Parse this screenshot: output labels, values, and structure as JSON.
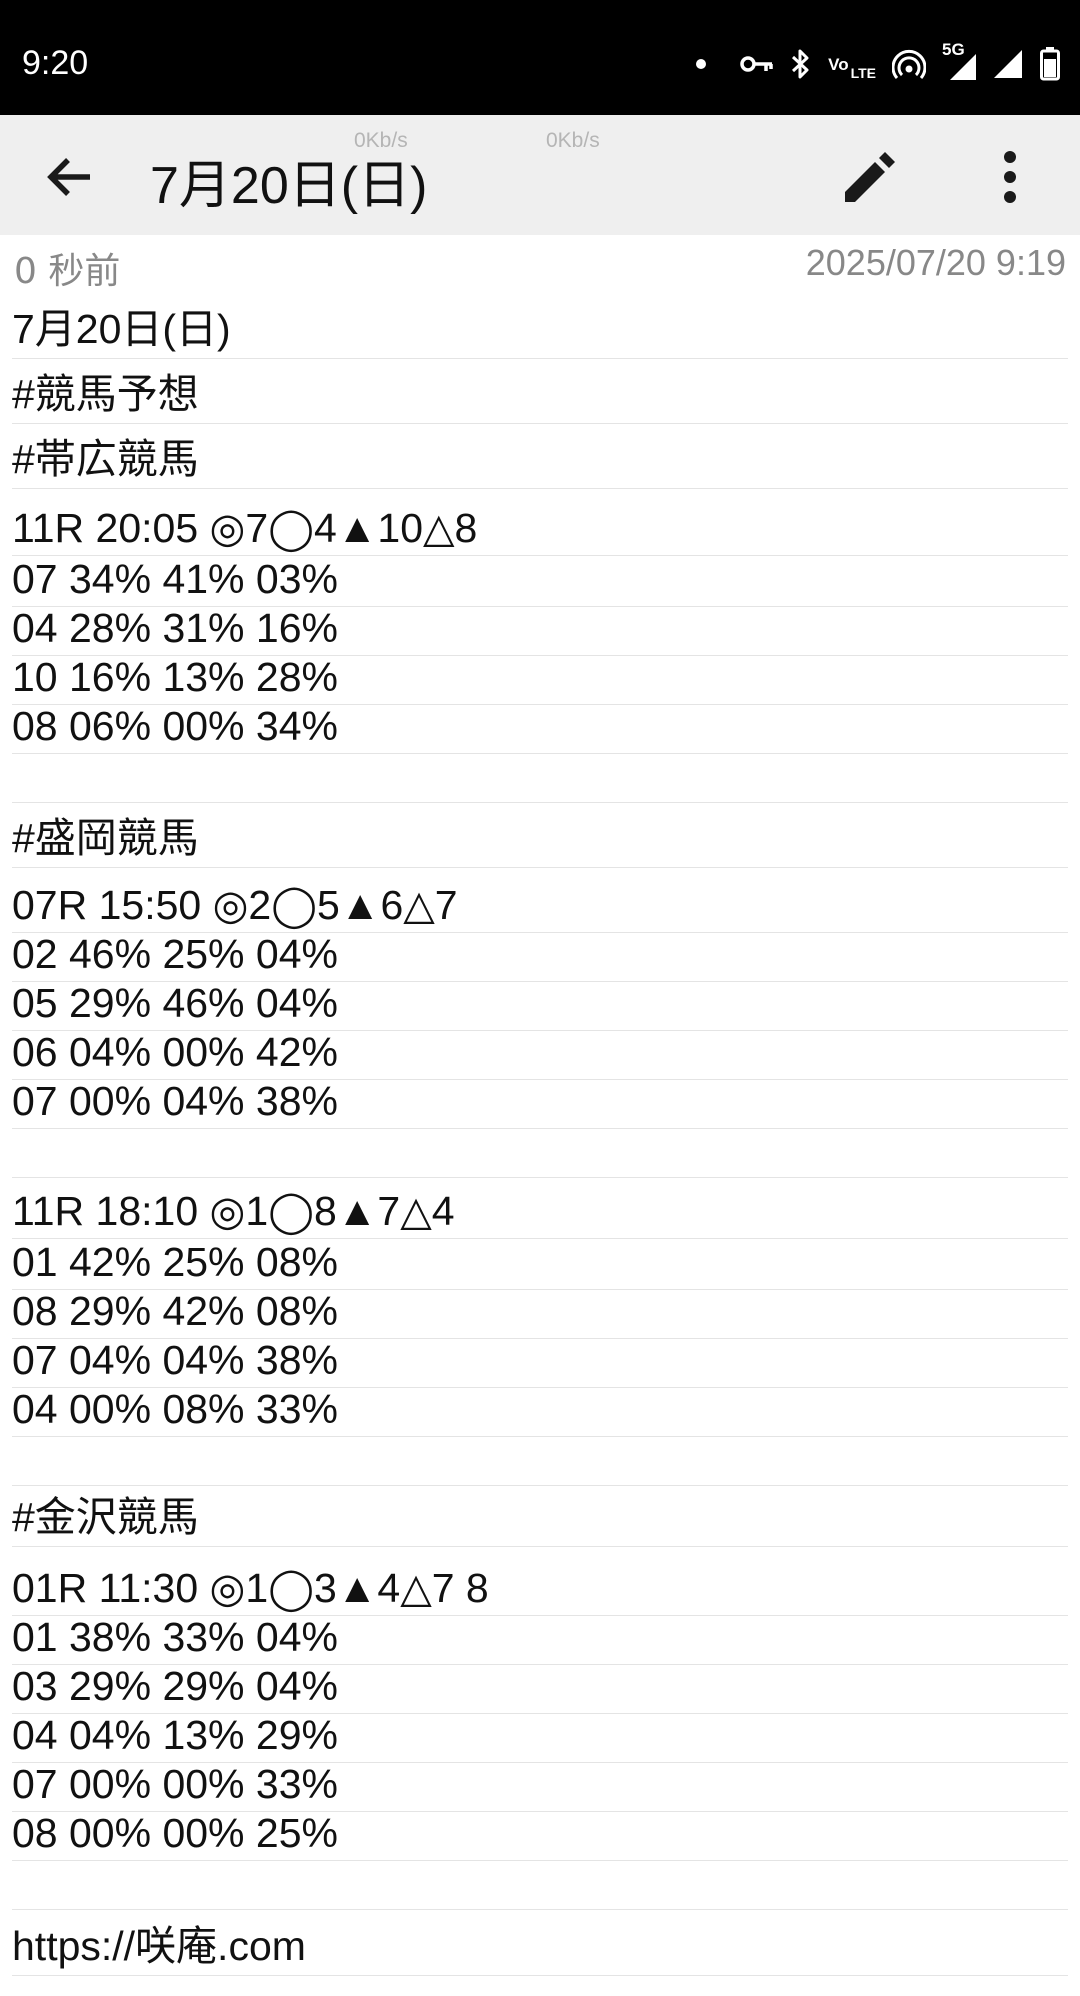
{
  "status_bar": {
    "time": "9:20",
    "icons": [
      "notification-dot-icon",
      "vpn-key-icon",
      "bluetooth-icon",
      "volte-icon",
      "hotspot-icon",
      "5g-signal-icon",
      "signal-icon",
      "battery-icon"
    ],
    "volte_label_top": "Vo",
    "volte_label_bottom": "LTE",
    "network_label": "5G"
  },
  "app_bar": {
    "title": "7月20日(日)",
    "net_speed_1": "0Kb/s",
    "net_speed_2": "0Kb/s",
    "icons": [
      "back-arrow-icon",
      "edit-pencil-icon",
      "more-vert-icon"
    ]
  },
  "meta": {
    "relative_time": "0 秒前",
    "timestamp": "2025/07/20 9:19"
  },
  "note_lines": [
    "7月20日(日)",
    "#競馬予想",
    "#帯広競馬",
    "11R 20:05 ◎7◯4▲10△8",
    "07 34% 41% 03%",
    "04 28% 31% 16%",
    "10 16% 13% 28%",
    "08 06% 00% 34%",
    "",
    "#盛岡競馬",
    "07R 15:50 ◎2◯5▲6△7",
    "02 46% 25% 04%",
    "05 29% 46% 04%",
    "06 04% 00% 42%",
    "07 00% 04% 38%",
    "",
    "11R 18:10 ◎1◯8▲7△4",
    "01 42% 25% 08%",
    "08 29% 42% 08%",
    "07 04% 04% 38%",
    "04 00% 08% 33%",
    "",
    "#金沢競馬",
    "01R 11:30 ◎1◯3▲4△7 8",
    "01 38% 33% 04%",
    "03 29% 29% 04%",
    "04 04% 13% 29%",
    "07 00% 00% 33%",
    "08 00% 00% 25%",
    "",
    "https://咲庵.com"
  ],
  "colors": {
    "status_bar_bg": "#000000",
    "app_bar_bg": "#efefef",
    "meta_text": "#888888",
    "rule": "#e4e4e4"
  }
}
